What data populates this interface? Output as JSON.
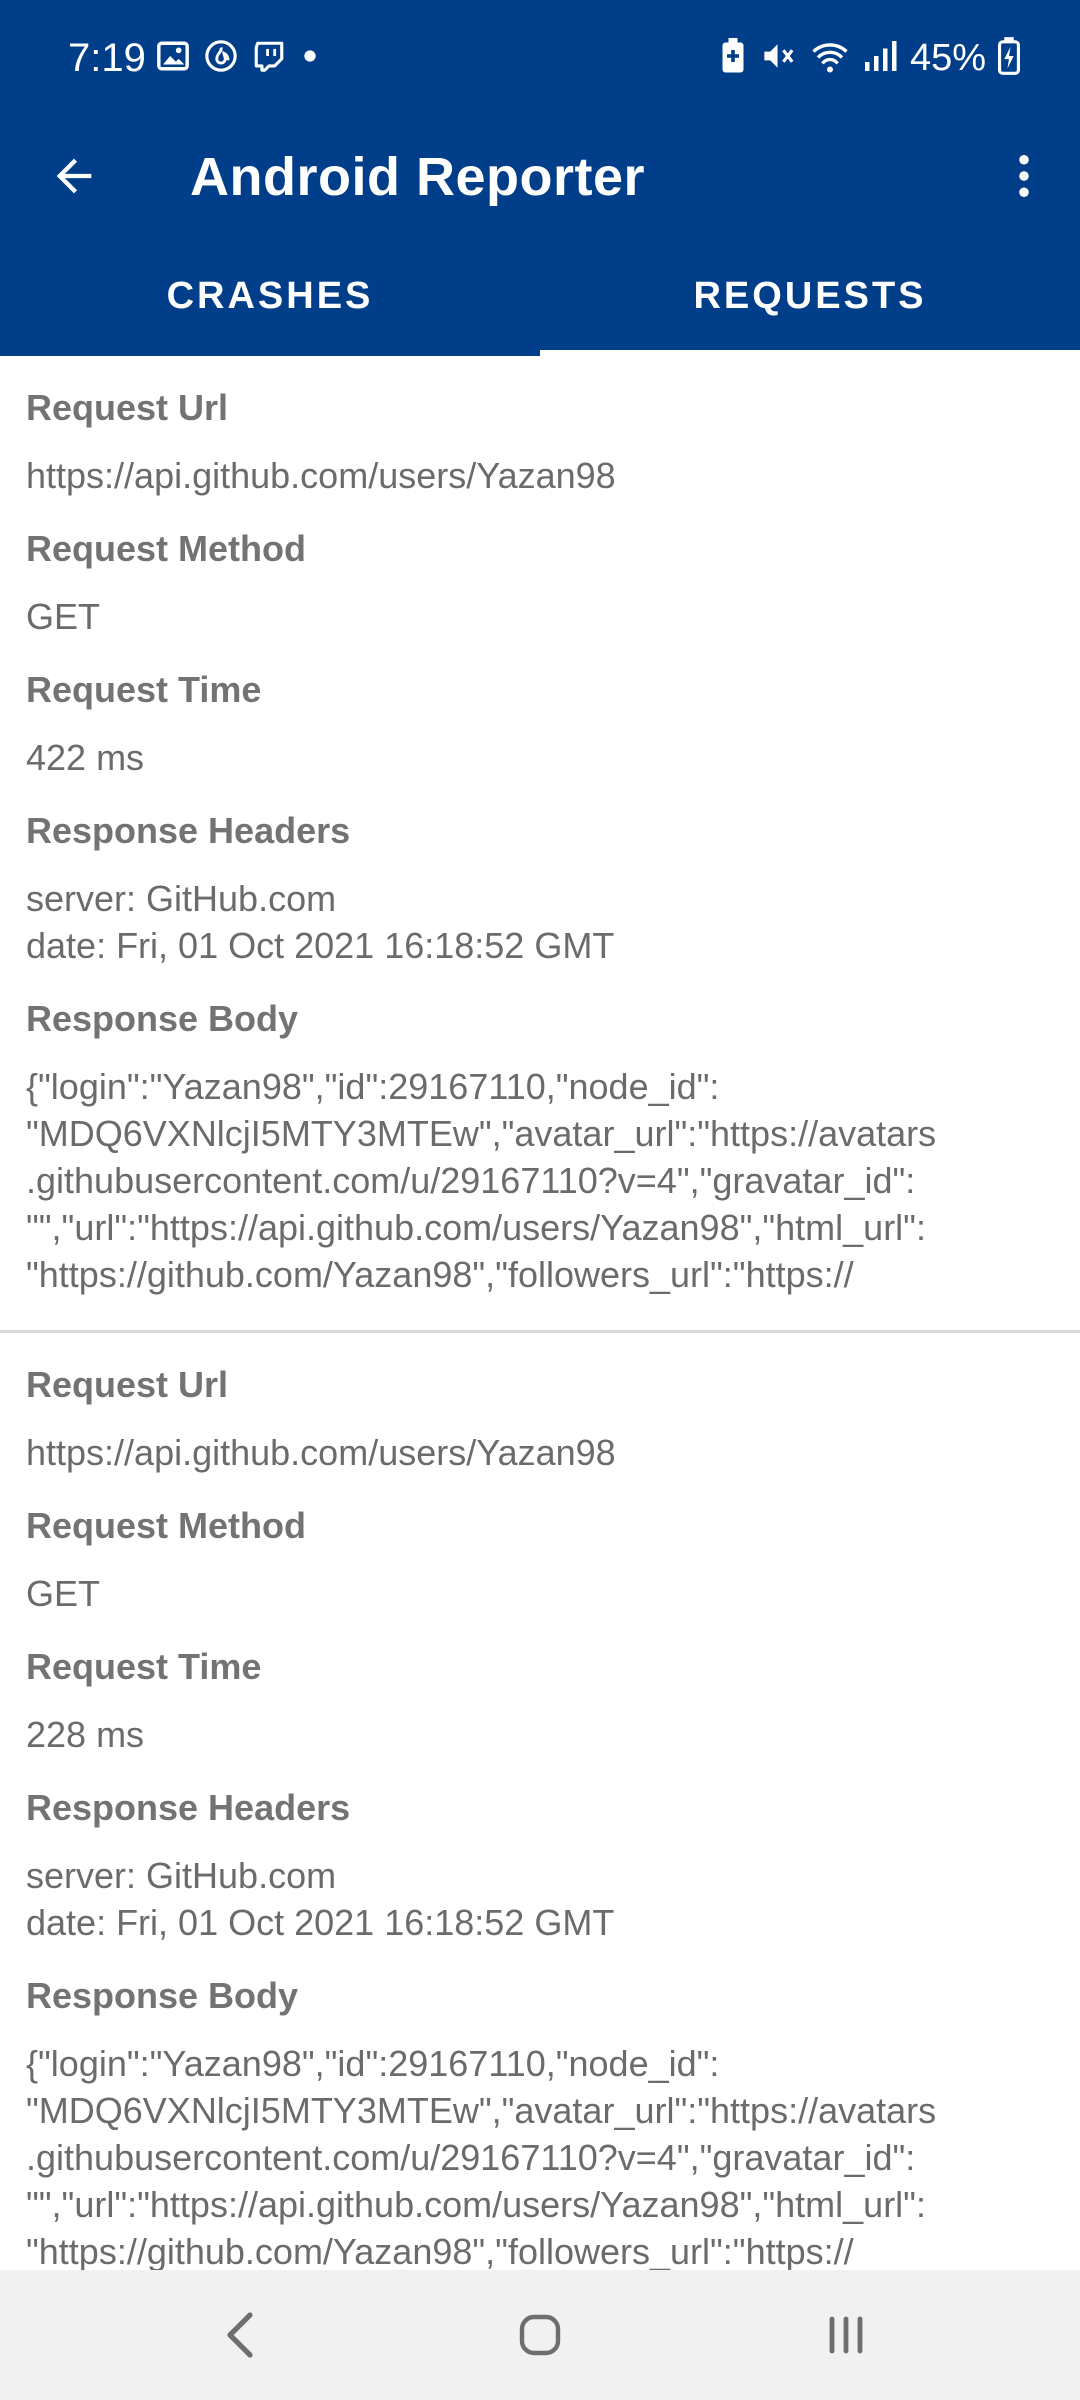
{
  "status_bar": {
    "time": "7:19",
    "battery": "45%",
    "left_icons": [
      "image-icon",
      "flame-icon",
      "twitch-icon",
      "dot-icon"
    ],
    "right_icons": [
      "battery-saver-icon",
      "mute-icon",
      "wifi-icon",
      "signal-icon",
      "battery-charging-icon"
    ]
  },
  "app_bar": {
    "title": "Android Reporter",
    "back_icon": "arrow-left-icon",
    "menu_icon": "more-vert-icon"
  },
  "tabs": [
    {
      "label": "CRASHES",
      "selected": false
    },
    {
      "label": "REQUESTS",
      "selected": true
    }
  ],
  "labels": {
    "url": "Request Url",
    "method": "Request Method",
    "time": "Request Time",
    "headers": "Response Headers",
    "body": "Response Body"
  },
  "requests": [
    {
      "url": "https://api.github.com/users/Yazan98",
      "method": "GET",
      "time": "422 ms",
      "headers": "server: GitHub.com\ndate: Fri, 01 Oct 2021 16:18:52 GMT",
      "body": "{\"login\":\"Yazan98\",\"id\":29167110,\"node_id\":\n\"MDQ6VXNlcjI5MTY3MTEw\",\"avatar_url\":\"https://avatars\n.githubusercontent.com/u/29167110?v=4\",\"gravatar_id\":\n\"\",\"url\":\"https://api.github.com/users/Yazan98\",\"html_url\":\n\"https://github.com/Yazan98\",\"followers_url\":\"https://"
    },
    {
      "url": "https://api.github.com/users/Yazan98",
      "method": "GET",
      "time": "228 ms",
      "headers": "server: GitHub.com\ndate: Fri, 01 Oct 2021 16:18:52 GMT",
      "body": "{\"login\":\"Yazan98\",\"id\":29167110,\"node_id\":\n\"MDQ6VXNlcjI5MTY3MTEw\",\"avatar_url\":\"https://avatars\n.githubusercontent.com/u/29167110?v=4\",\"gravatar_id\":\n\"\",\"url\":\"https://api.github.com/users/Yazan98\",\"html_url\":\n\"https://github.com/Yazan98\",\"followers_url\":\"https://"
    }
  ],
  "nav_bar": {
    "icons": [
      "nav-back-icon",
      "nav-home-icon",
      "nav-recents-icon"
    ]
  },
  "colors": {
    "primary": "#013e8a",
    "label": "#737373",
    "value": "#6b6b6b",
    "nav_bg": "#f1f1f1"
  }
}
